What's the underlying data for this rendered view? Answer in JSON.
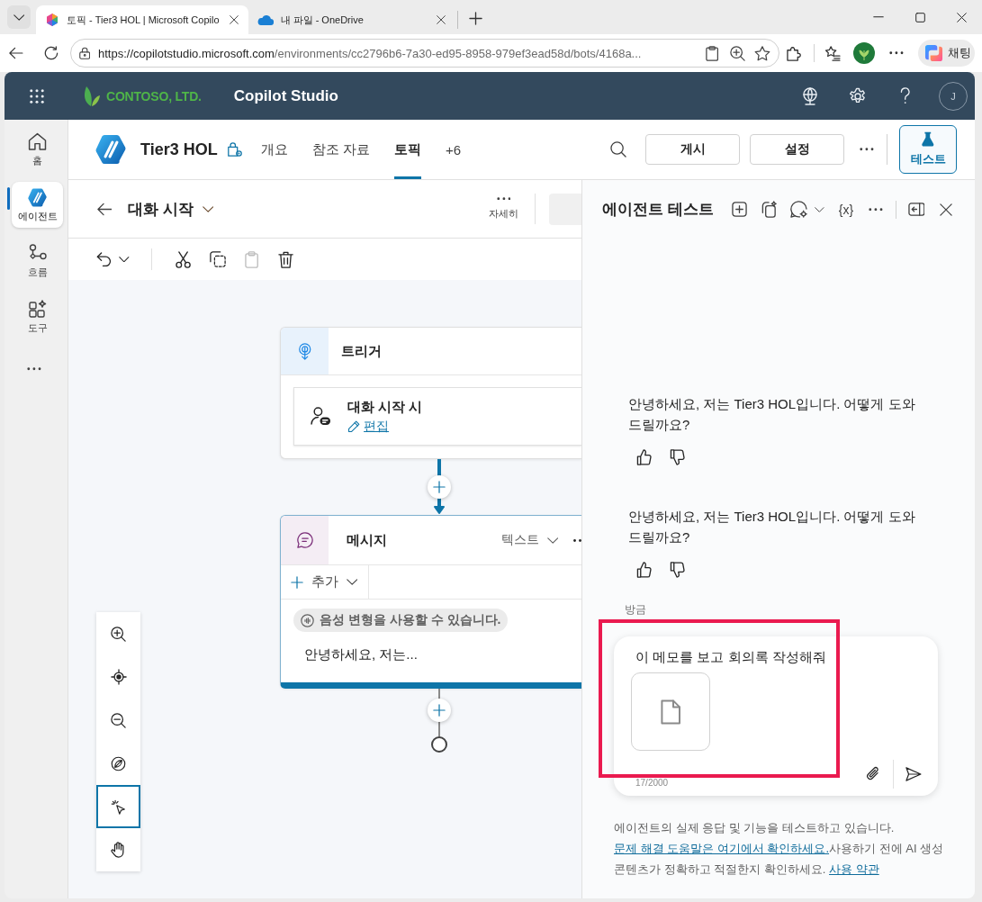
{
  "browser": {
    "tabs": [
      {
        "title": "토픽 - Tier3 HOL | Microsoft Copilo",
        "kind": "hexagon",
        "selected": true
      },
      {
        "title": "내 파일 - OneDrive",
        "kind": "cloud",
        "selected": false
      }
    ],
    "url": {
      "origin": "https://copilotstudio.microsoft.com",
      "path": "/environments/cc2796b6-7a30-ed95-8958-979ef3ead58d/bots/4168a..."
    },
    "chat_button": "채팅"
  },
  "app_header": {
    "company": "CONTOSO, LTD.",
    "product": "Copilot Studio",
    "avatar_initial": "J"
  },
  "nav_rail": {
    "items": [
      {
        "label": "홈",
        "kind": "home",
        "selected": false
      },
      {
        "label": "에이전트",
        "kind": "agent",
        "selected": true
      },
      {
        "label": "흐름",
        "kind": "flow",
        "selected": false
      },
      {
        "label": "도구",
        "kind": "tools",
        "selected": false
      }
    ]
  },
  "agent_bar": {
    "name": "Tier3 HOL",
    "tabs": [
      {
        "label": "개요",
        "selected": false
      },
      {
        "label": "참조 자료",
        "selected": false
      },
      {
        "label": "토픽",
        "selected": true
      },
      {
        "label": "+6",
        "selected": false
      }
    ],
    "actions": [
      "게시",
      "설정"
    ],
    "test_button": {
      "label": "테스트",
      "selected": true
    }
  },
  "topic": {
    "title": "대화 시작",
    "details_label": "자세히",
    "tools": [
      {
        "kind": "undo",
        "disabled": false
      },
      {
        "kind": "cut",
        "disabled": false
      },
      {
        "kind": "copy",
        "disabled": false
      },
      {
        "kind": "paste",
        "disabled": true
      },
      {
        "kind": "delete",
        "disabled": false
      }
    ]
  },
  "canvas": {
    "nodes": [
      {
        "kind": "trigger",
        "title": "트리거",
        "event": "대화 시작 시",
        "edit_link": "편집"
      },
      {
        "kind": "message",
        "title": "메시지",
        "format": "텍스트",
        "add_label": "추가",
        "badge": "음성 변형을 사용할 수 있습니다.",
        "text": "안녕하세요, 저는..."
      }
    ],
    "zoom_tools": [
      {
        "kind": "zoom-in",
        "selected": false
      },
      {
        "kind": "center",
        "selected": false
      },
      {
        "kind": "zoom-out",
        "selected": false
      },
      {
        "kind": "hide-map",
        "selected": false
      },
      {
        "kind": "select",
        "selected": true
      },
      {
        "kind": "pan",
        "selected": false
      }
    ]
  },
  "test_panel": {
    "title": "에이전트 테스트",
    "variables_label": "{x}",
    "messages": [
      {
        "text": "안녕하세요, 저는 Tier3 HOL입니다. 어떻게 도와드릴까요?"
      },
      {
        "text": "안녕하세요, 저는 Tier3 HOL입니다. 어떻게 도와드릴까요?"
      }
    ],
    "timestamp": "방금",
    "composer": {
      "value": "이 메모를 보고 회의록 작성해줘",
      "attachments": [
        {
          "kind": "file"
        }
      ],
      "counter": "17/2000"
    },
    "disclaimer": [
      {
        "kind": "text",
        "text": "에이전트의 실제 응답 및 기능을 테스트하고 있습니다. "
      },
      {
        "kind": "link",
        "text": "문제 해결 도움말은 여기에서 확인하세요."
      },
      {
        "kind": "text",
        "text": "사용하기 전에 AI 생성 콘텐츠가 정확하고 적절한지 확인하세요. "
      },
      {
        "kind": "link",
        "text": "사용 약관"
      }
    ]
  }
}
